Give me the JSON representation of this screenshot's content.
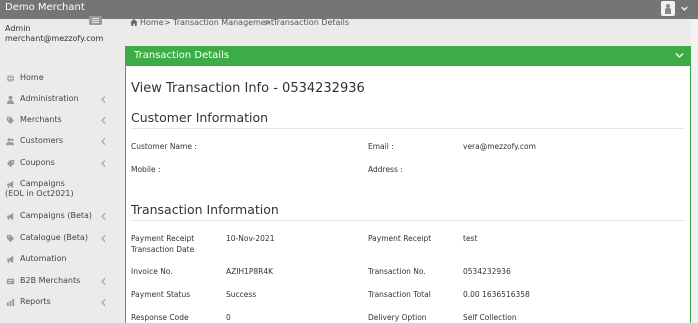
{
  "app": {
    "brand": "Demo Merchant"
  },
  "user": {
    "role": "Admin",
    "email": "merchant@mezzofy.com"
  },
  "sidebar": {
    "items": [
      {
        "label": "Home",
        "icon": "globe-icon"
      },
      {
        "label": "Administration",
        "icon": "user-icon"
      },
      {
        "label": "Merchants",
        "icon": "tag-icon"
      },
      {
        "label": "Customers",
        "icon": "users-icon"
      },
      {
        "label": "Coupons",
        "icon": "coupon-icon"
      },
      {
        "label": "Campaigns",
        "label2": "(EOL in Oct2021)",
        "icon": "megaphone-icon"
      },
      {
        "label": "Campaigns (Beta)",
        "icon": "megaphone-icon"
      },
      {
        "label": "Catalogue (Beta)",
        "icon": "tag-icon"
      },
      {
        "label": "Automation",
        "icon": "megaphone-icon"
      },
      {
        "label": "B2B Merchants",
        "icon": "b2b-icon"
      },
      {
        "label": "Reports",
        "icon": "chart-icon"
      }
    ]
  },
  "breadcrumb": {
    "home": "Home",
    "section": "Transaction Management",
    "page": "Transaction Details"
  },
  "panel": {
    "title": "Transaction Details"
  },
  "view": {
    "title": "View Transaction Info - 0534232936"
  },
  "customer": {
    "heading": "Customer Information",
    "name_label": "Customer Name :",
    "name_value": "",
    "email_label": "Email :",
    "email_value": "vera@mezzofy.com",
    "mobile_label": "Mobile :",
    "mobile_value": "",
    "address_label": "Address :",
    "address_value": ""
  },
  "transaction": {
    "heading": "Transaction Information",
    "rows": [
      {
        "l1": "Payment Receipt",
        "l1b": "Transaction Date",
        "v1": "10-Nov-2021",
        "l2": "Payment Receipt",
        "v2": "test"
      },
      {
        "l1": "Invoice No.",
        "v1": "AZIH1P8R4K",
        "l2": "Transaction No.",
        "v2": "0534232936"
      },
      {
        "l1": "Payment Status",
        "v1": "Success",
        "l2": "Transaction Total",
        "v2": "0.00 1636516358"
      },
      {
        "l1": "Response Code",
        "v1": "0",
        "l2": "Delivery Option",
        "v2": "Self Collection"
      }
    ]
  },
  "colors": {
    "topbar": "#757575",
    "accent": "#3cad46",
    "sidebar": "#ebebeb"
  }
}
